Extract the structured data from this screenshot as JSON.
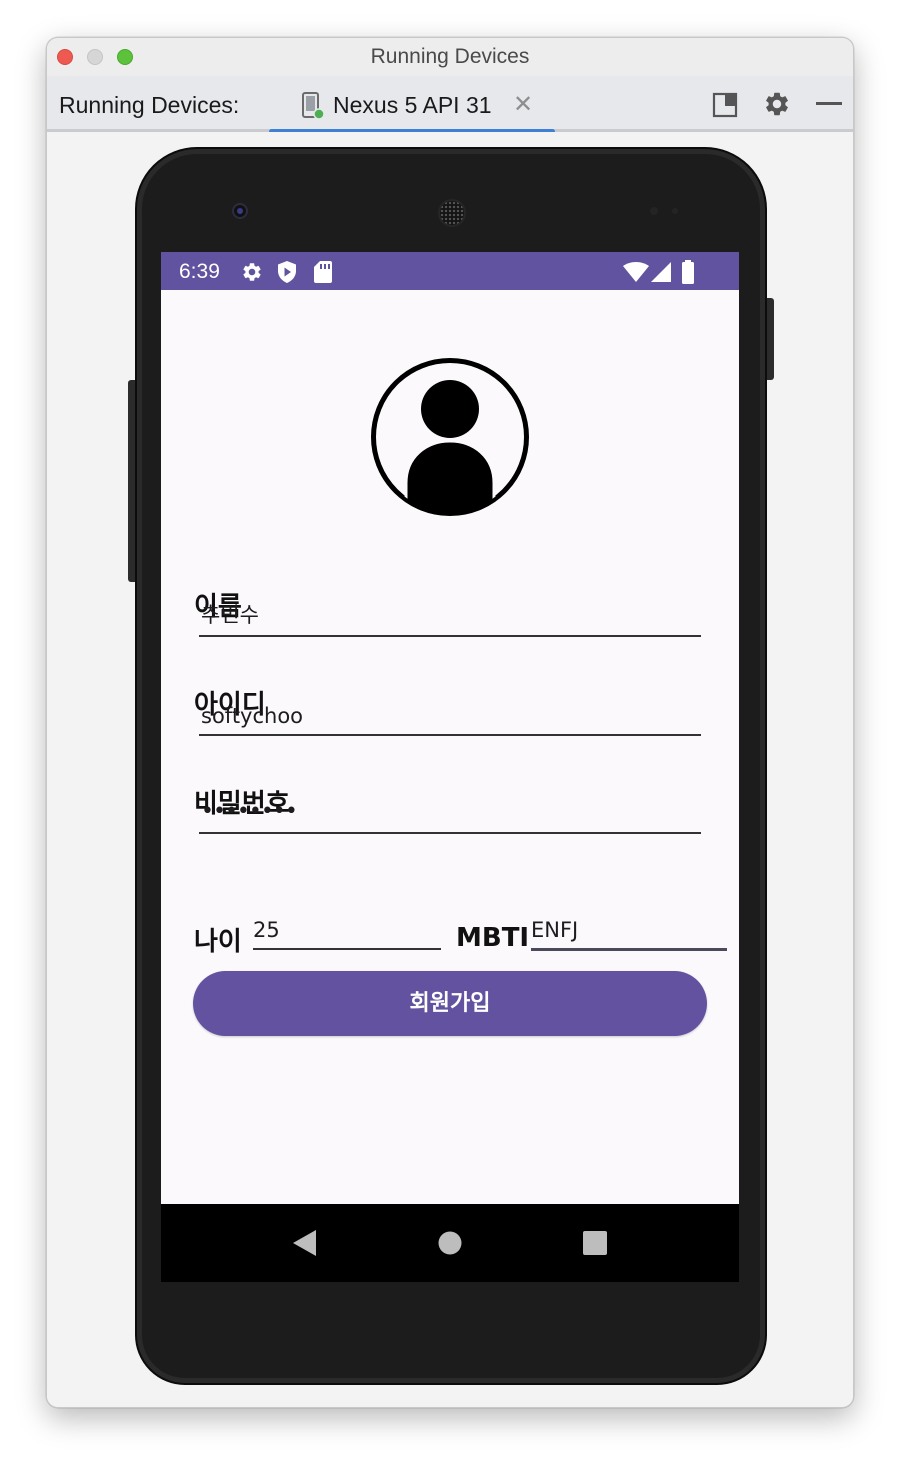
{
  "window": {
    "title": "Running Devices"
  },
  "toolbar": {
    "label": "Running Devices:",
    "tab_label": "Nexus 5 API 31",
    "tab_close": "✕"
  },
  "status_bar": {
    "time": "6:39"
  },
  "form": {
    "name_label": "이름",
    "name_value": "추민수",
    "id_label": "아이디",
    "id_value": "softychoo",
    "password_label": "비밀번호",
    "password_value": "••••••••",
    "age_label": "나이",
    "age_value": "25",
    "mbti_label": "MBTI",
    "mbti_value": "ENFJ",
    "signup_button": "회원가입"
  },
  "colors": {
    "accent": "#6253a0",
    "status_bar": "#6253a0",
    "tab_indicator": "#3f7fd6",
    "screen_bg": "#fcf9fd"
  },
  "icons": {
    "status_left": [
      "settings-icon",
      "shield-play-icon",
      "sd-card-icon"
    ],
    "status_right": [
      "wifi-icon",
      "signal-icon",
      "battery-icon"
    ],
    "navigation": [
      "back-icon",
      "home-icon",
      "recents-icon"
    ],
    "toolbar": [
      "device-icon",
      "layout-icon",
      "gear-icon",
      "minimize-icon"
    ]
  }
}
